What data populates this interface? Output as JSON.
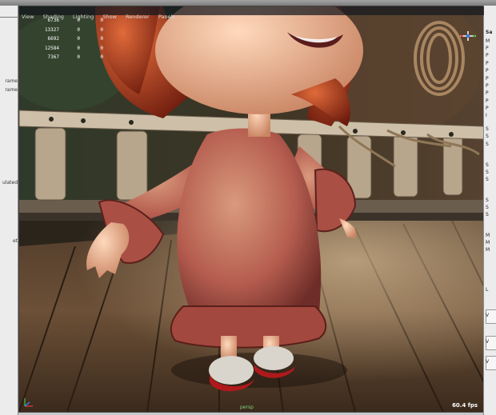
{
  "left_panel": {
    "stubs": [
      "rame",
      "rame",
      "ulated",
      "et"
    ]
  },
  "viewport": {
    "menu": [
      "View",
      "Shading",
      "Lighting",
      "Show",
      "Renderer",
      "Panels"
    ],
    "hud_rows": [
      [
        "6736",
        "0",
        "0"
      ],
      [
        "13327",
        "0",
        "0"
      ],
      [
        "6692",
        "0",
        "0"
      ],
      [
        "12584",
        "0",
        "0"
      ],
      [
        "7367",
        "0",
        "0"
      ]
    ],
    "fps": "60.4 fps",
    "camera": "persp"
  },
  "right_panel": {
    "stubs": [
      "Sa",
      "M",
      "P",
      "P",
      "P",
      "P",
      "P",
      "P",
      "P",
      "P",
      "P",
      "I",
      "S",
      "S",
      "S",
      "S",
      "S",
      "S",
      "S",
      "S",
      "S",
      "M",
      "M",
      "M",
      "L",
      "V",
      "V",
      "V"
    ]
  },
  "colors": {
    "viewport_bg": "#2b241b",
    "menu_text": "#d8d8d8",
    "hud_text": "#ffffff",
    "camera_label": "#7fd47f",
    "dress": "#b55d4f",
    "skin": "#f0b894",
    "hair": "#b63a1e"
  },
  "icons": {
    "axis": "xyz-axis-icon",
    "nav": "view-navigation-icon"
  }
}
